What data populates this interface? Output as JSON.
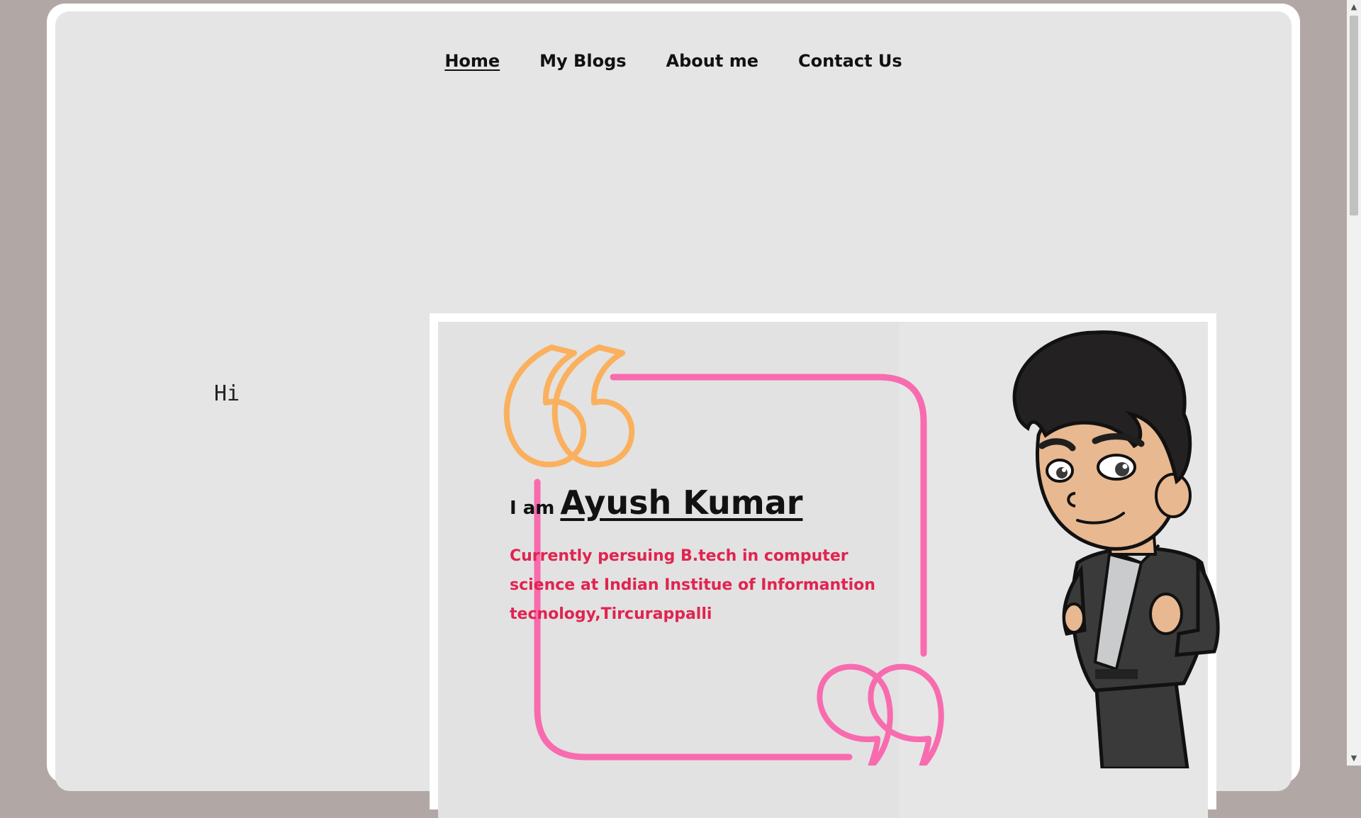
{
  "nav": {
    "items": [
      {
        "label": "Home",
        "active": true
      },
      {
        "label": "My Blogs",
        "active": false
      },
      {
        "label": "About me",
        "active": false
      },
      {
        "label": "Contact Us",
        "active": false
      }
    ]
  },
  "hero": {
    "greeting": "Hi",
    "intro_prefix": "I am",
    "name": "Ayush Kumar",
    "description": "Currently persuing B.tech in computer science at Indian Institue of Informantion tecnology,Tircurappalli"
  },
  "icons": {
    "open_quote": "open-quote-icon",
    "close_quote": "close-quote-icon",
    "avatar": "cartoon-avatar"
  },
  "colors": {
    "page_background": "#b1a8a6",
    "panel_background": "#e5e5e5",
    "quote_orange": "#fbb05e",
    "quote_pink": "#f86bae",
    "description_text": "#e0244f"
  }
}
